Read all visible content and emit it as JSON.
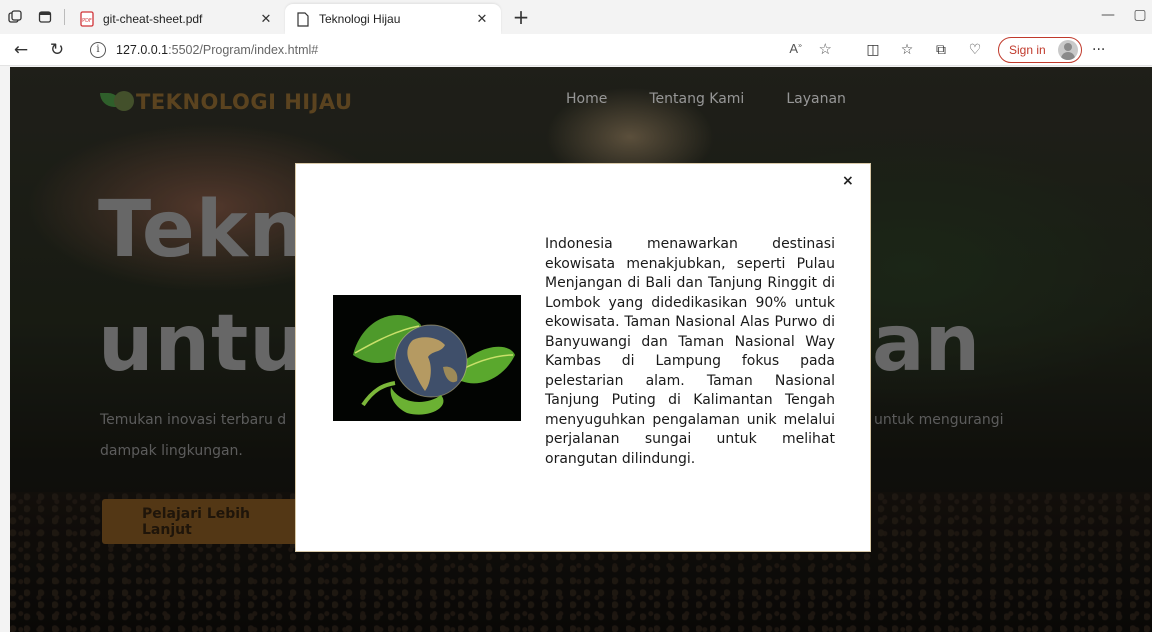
{
  "browser": {
    "tabs": [
      {
        "title": "git-cheat-sheet.pdf"
      },
      {
        "title": "Teknologi Hijau"
      }
    ],
    "url": {
      "host": "127.0.0.1",
      "path": ":5502/Program/index.html#"
    },
    "sign_in": "Sign in"
  },
  "site": {
    "logo_text": "TEKNOLOGI HIJAU",
    "nav": [
      "Home",
      "Tentang Kami",
      "Layanan"
    ],
    "hero": {
      "line1": "Tekn",
      "line2_left": "untu",
      "line2_right": "an",
      "desc_left": "Temukan inovasi terbaru d",
      "desc_right": "untuk mengurangi",
      "desc_line2": "dampak lingkungan.",
      "cta": "Pelajari Lebih Lanjut"
    }
  },
  "modal": {
    "close": "×",
    "text": "Indonesia menawarkan destinasi ekowisata menakjubkan, seperti Pulau Menjangan di Bali dan Tanjung Ringgit di Lombok yang didedikasikan 90% untuk ekowisata. Taman Nasional Alas Purwo di Banyuwangi dan Taman Nasional Way Kambas di Lampung fokus pada pelestarian alam. Taman Nasional Tanjung Puting di Kalimantan Tengah menyuguhkan pengalaman unik melalui perjalanan sungai untuk melihat orangutan dilindungi."
  }
}
